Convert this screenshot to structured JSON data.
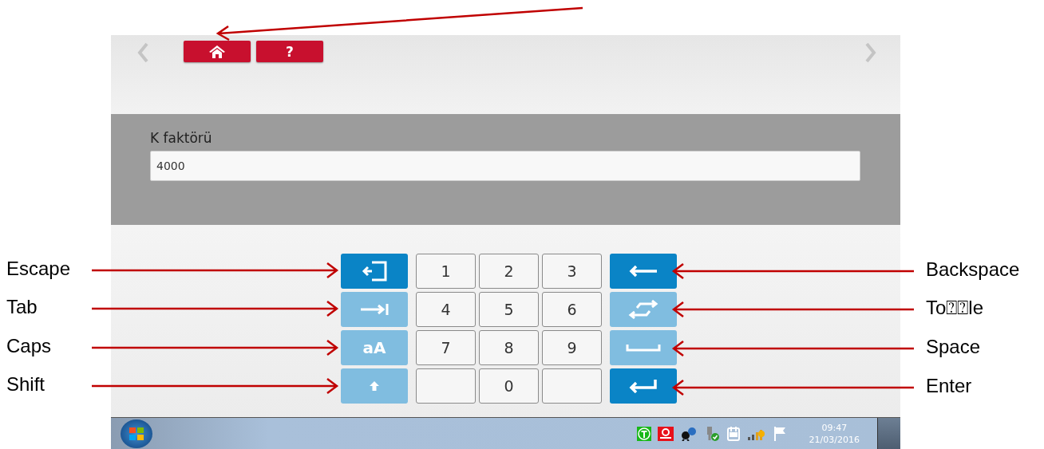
{
  "toolbar": {
    "help_button": {
      "label": "?"
    }
  },
  "field": {
    "label": "K faktörü",
    "value": "4000"
  },
  "keypad": {
    "left_keys": [
      {
        "kind": "icon",
        "disabled": false
      },
      {
        "kind": "icon",
        "disabled": true
      },
      {
        "kind": "text",
        "label": "aA",
        "disabled": true
      },
      {
        "kind": "icon",
        "disabled": true
      }
    ],
    "digit_keys": [
      {
        "kind": "digit",
        "label": "1"
      },
      {
        "kind": "digit",
        "label": "2"
      },
      {
        "kind": "digit",
        "label": "3"
      },
      {
        "kind": "digit",
        "label": "4"
      },
      {
        "kind": "digit",
        "label": "5"
      },
      {
        "kind": "digit",
        "label": "6"
      },
      {
        "kind": "digit",
        "label": "7"
      },
      {
        "kind": "digit",
        "label": "8"
      },
      {
        "kind": "digit",
        "label": "9"
      },
      {
        "kind": "blank"
      },
      {
        "kind": "digit",
        "label": "0"
      },
      {
        "kind": "blank"
      }
    ],
    "right_keys": [
      {
        "kind": "icon",
        "disabled": false
      },
      {
        "kind": "icon",
        "disabled": true
      },
      {
        "kind": "icon",
        "disabled": true
      },
      {
        "kind": "icon",
        "disabled": false
      }
    ]
  },
  "taskbar": {
    "time": "09:47",
    "date": "21/03/2016"
  },
  "annotations": {
    "left": [
      "Escape",
      "Tab",
      "Caps",
      "Shift"
    ],
    "right": [
      "Backspace",
      "To⍰⍰le",
      "Space",
      "Enter"
    ]
  }
}
